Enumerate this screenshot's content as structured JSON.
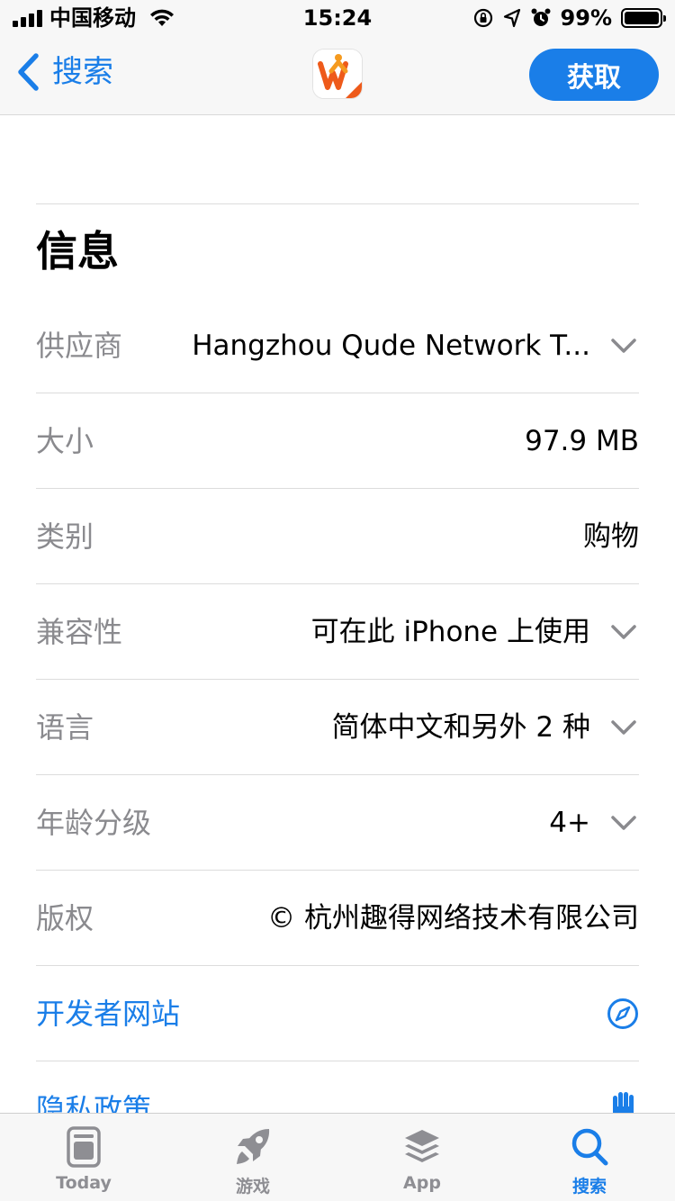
{
  "status_bar": {
    "carrier": "中国移动",
    "time": "15:24",
    "battery_percent": "99%",
    "battery_level": 0.99,
    "icons": [
      "signal-icon",
      "wifi-icon",
      "orientation-lock-icon",
      "location-icon",
      "alarm-icon",
      "battery-icon"
    ]
  },
  "nav": {
    "back_label": "搜索",
    "get_label": "获取",
    "accent_color": "#1a7ee8"
  },
  "info": {
    "title": "信息",
    "rows": [
      {
        "label": "供应商",
        "value": "Hangzhou Qude Network T..."
      },
      {
        "label": "大小",
        "value": "97.9 MB"
      },
      {
        "label": "类别",
        "value": "购物"
      },
      {
        "label": "兼容性",
        "value": "可在此 iPhone 上使用"
      },
      {
        "label": "语言",
        "value": "简体中文和另外 2 种"
      },
      {
        "label": "年龄分级",
        "value": "4+"
      },
      {
        "label": "版权",
        "value": "© 杭州趣得网络技术有限公司"
      }
    ],
    "links": [
      {
        "label": "开发者网站",
        "icon": "safari-compass-icon"
      },
      {
        "label": "隐私政策",
        "icon": "privacy-hand-icon"
      }
    ]
  },
  "tab_bar": {
    "tabs": [
      {
        "label": "Today",
        "icon": "today-icon",
        "active": false
      },
      {
        "label": "游戏",
        "icon": "rocket-icon",
        "active": false
      },
      {
        "label": "App",
        "icon": "layers-icon",
        "active": false
      },
      {
        "label": "搜索",
        "icon": "search-icon",
        "active": true
      }
    ]
  }
}
